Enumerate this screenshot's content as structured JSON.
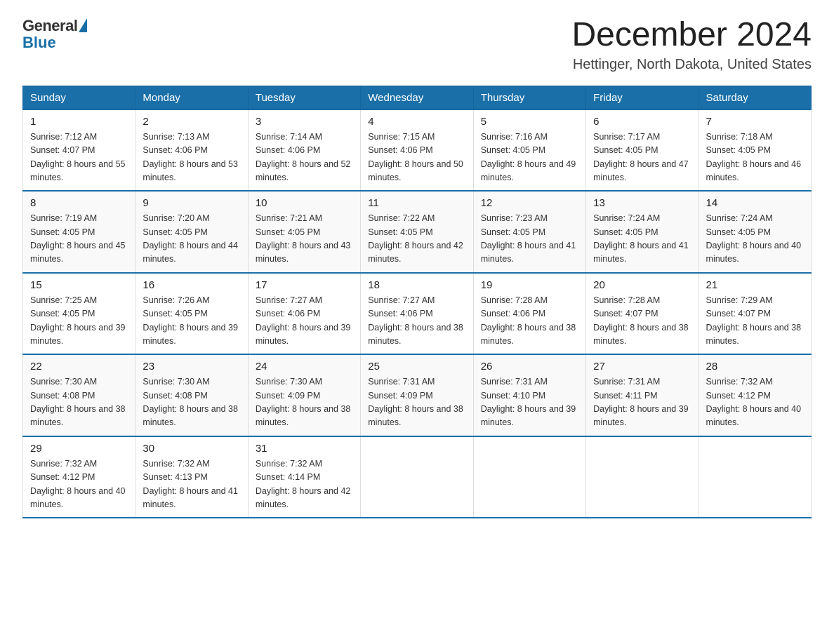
{
  "logo": {
    "general": "General",
    "blue": "Blue"
  },
  "header": {
    "month_title": "December 2024",
    "location": "Hettinger, North Dakota, United States"
  },
  "days_of_week": [
    "Sunday",
    "Monday",
    "Tuesday",
    "Wednesday",
    "Thursday",
    "Friday",
    "Saturday"
  ],
  "weeks": [
    [
      {
        "day": "1",
        "sunrise": "7:12 AM",
        "sunset": "4:07 PM",
        "daylight": "8 hours and 55 minutes."
      },
      {
        "day": "2",
        "sunrise": "7:13 AM",
        "sunset": "4:06 PM",
        "daylight": "8 hours and 53 minutes."
      },
      {
        "day": "3",
        "sunrise": "7:14 AM",
        "sunset": "4:06 PM",
        "daylight": "8 hours and 52 minutes."
      },
      {
        "day": "4",
        "sunrise": "7:15 AM",
        "sunset": "4:06 PM",
        "daylight": "8 hours and 50 minutes."
      },
      {
        "day": "5",
        "sunrise": "7:16 AM",
        "sunset": "4:05 PM",
        "daylight": "8 hours and 49 minutes."
      },
      {
        "day": "6",
        "sunrise": "7:17 AM",
        "sunset": "4:05 PM",
        "daylight": "8 hours and 47 minutes."
      },
      {
        "day": "7",
        "sunrise": "7:18 AM",
        "sunset": "4:05 PM",
        "daylight": "8 hours and 46 minutes."
      }
    ],
    [
      {
        "day": "8",
        "sunrise": "7:19 AM",
        "sunset": "4:05 PM",
        "daylight": "8 hours and 45 minutes."
      },
      {
        "day": "9",
        "sunrise": "7:20 AM",
        "sunset": "4:05 PM",
        "daylight": "8 hours and 44 minutes."
      },
      {
        "day": "10",
        "sunrise": "7:21 AM",
        "sunset": "4:05 PM",
        "daylight": "8 hours and 43 minutes."
      },
      {
        "day": "11",
        "sunrise": "7:22 AM",
        "sunset": "4:05 PM",
        "daylight": "8 hours and 42 minutes."
      },
      {
        "day": "12",
        "sunrise": "7:23 AM",
        "sunset": "4:05 PM",
        "daylight": "8 hours and 41 minutes."
      },
      {
        "day": "13",
        "sunrise": "7:24 AM",
        "sunset": "4:05 PM",
        "daylight": "8 hours and 41 minutes."
      },
      {
        "day": "14",
        "sunrise": "7:24 AM",
        "sunset": "4:05 PM",
        "daylight": "8 hours and 40 minutes."
      }
    ],
    [
      {
        "day": "15",
        "sunrise": "7:25 AM",
        "sunset": "4:05 PM",
        "daylight": "8 hours and 39 minutes."
      },
      {
        "day": "16",
        "sunrise": "7:26 AM",
        "sunset": "4:05 PM",
        "daylight": "8 hours and 39 minutes."
      },
      {
        "day": "17",
        "sunrise": "7:27 AM",
        "sunset": "4:06 PM",
        "daylight": "8 hours and 39 minutes."
      },
      {
        "day": "18",
        "sunrise": "7:27 AM",
        "sunset": "4:06 PM",
        "daylight": "8 hours and 38 minutes."
      },
      {
        "day": "19",
        "sunrise": "7:28 AM",
        "sunset": "4:06 PM",
        "daylight": "8 hours and 38 minutes."
      },
      {
        "day": "20",
        "sunrise": "7:28 AM",
        "sunset": "4:07 PM",
        "daylight": "8 hours and 38 minutes."
      },
      {
        "day": "21",
        "sunrise": "7:29 AM",
        "sunset": "4:07 PM",
        "daylight": "8 hours and 38 minutes."
      }
    ],
    [
      {
        "day": "22",
        "sunrise": "7:30 AM",
        "sunset": "4:08 PM",
        "daylight": "8 hours and 38 minutes."
      },
      {
        "day": "23",
        "sunrise": "7:30 AM",
        "sunset": "4:08 PM",
        "daylight": "8 hours and 38 minutes."
      },
      {
        "day": "24",
        "sunrise": "7:30 AM",
        "sunset": "4:09 PM",
        "daylight": "8 hours and 38 minutes."
      },
      {
        "day": "25",
        "sunrise": "7:31 AM",
        "sunset": "4:09 PM",
        "daylight": "8 hours and 38 minutes."
      },
      {
        "day": "26",
        "sunrise": "7:31 AM",
        "sunset": "4:10 PM",
        "daylight": "8 hours and 39 minutes."
      },
      {
        "day": "27",
        "sunrise": "7:31 AM",
        "sunset": "4:11 PM",
        "daylight": "8 hours and 39 minutes."
      },
      {
        "day": "28",
        "sunrise": "7:32 AM",
        "sunset": "4:12 PM",
        "daylight": "8 hours and 40 minutes."
      }
    ],
    [
      {
        "day": "29",
        "sunrise": "7:32 AM",
        "sunset": "4:12 PM",
        "daylight": "8 hours and 40 minutes."
      },
      {
        "day": "30",
        "sunrise": "7:32 AM",
        "sunset": "4:13 PM",
        "daylight": "8 hours and 41 minutes."
      },
      {
        "day": "31",
        "sunrise": "7:32 AM",
        "sunset": "4:14 PM",
        "daylight": "8 hours and 42 minutes."
      },
      null,
      null,
      null,
      null
    ]
  ],
  "labels": {
    "sunrise": "Sunrise:",
    "sunset": "Sunset:",
    "daylight": "Daylight:"
  }
}
